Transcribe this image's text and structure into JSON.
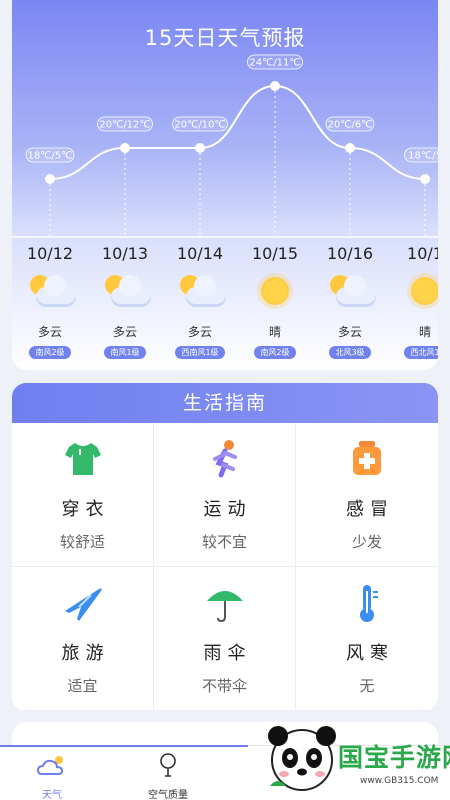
{
  "forecast": {
    "title": "15天日天气预报",
    "days": [
      {
        "date": "10/12",
        "temp": "18℃/5℃",
        "desc": "多云",
        "wind": "南风2级",
        "icon": "partly-cloudy-icon"
      },
      {
        "date": "10/13",
        "temp": "20℃/12℃",
        "desc": "多云",
        "wind": "南风1级",
        "icon": "partly-cloudy-icon"
      },
      {
        "date": "10/14",
        "temp": "20℃/10℃",
        "desc": "多云",
        "wind": "西南风1级",
        "icon": "partly-cloudy-icon"
      },
      {
        "date": "10/15",
        "temp": "24℃/11℃",
        "desc": "晴",
        "wind": "南风2级",
        "icon": "sun-icon"
      },
      {
        "date": "10/16",
        "temp": "20℃/6℃",
        "desc": "多云",
        "wind": "北风3级",
        "icon": "partly-cloudy-icon"
      },
      {
        "date": "10/1",
        "temp": "18℃/5",
        "desc": "晴",
        "wind": "西北风1",
        "icon": "sun-icon"
      }
    ],
    "high_temps": [
      18,
      20,
      20,
      24,
      20,
      18
    ]
  },
  "guide": {
    "title": "生活指南",
    "items": [
      {
        "name": "穿衣",
        "value": "较舒适",
        "icon": "shirt-icon"
      },
      {
        "name": "运动",
        "value": "较不宜",
        "icon": "running-icon"
      },
      {
        "name": "感冒",
        "value": "少发",
        "icon": "medicine-icon"
      },
      {
        "name": "旅游",
        "value": "适宜",
        "icon": "airplane-icon"
      },
      {
        "name": "雨伞",
        "value": "不带伞",
        "icon": "umbrella-icon"
      },
      {
        "name": "风寒",
        "value": "无",
        "icon": "thermometer-icon"
      }
    ]
  },
  "tabs": [
    {
      "label": "天气",
      "icon": "weather-icon",
      "active": true
    },
    {
      "label": "空气质量",
      "icon": "air-quality-icon",
      "active": false
    }
  ],
  "watermark": {
    "text": "国宝手游网",
    "sub": "www.GB315.COM"
  },
  "colors": {
    "accent": "#6f7ff0",
    "watermark_green": "#2aa84a"
  }
}
